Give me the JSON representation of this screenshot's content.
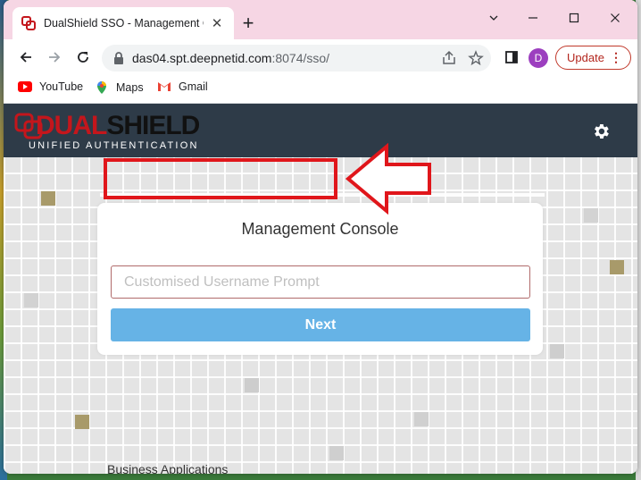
{
  "browser": {
    "tab_title": "DualShield SSO - Management C",
    "new_tab_symbol": "+",
    "url_host": "das04.spt.deepnetid.com",
    "url_rest": ":8074/sso/",
    "profile_initial": "D",
    "update_label": "Update",
    "window_controls": {
      "minimize": "—",
      "maximize": "☐",
      "close": "✕"
    }
  },
  "bookmarks": [
    {
      "label": "YouTube",
      "icon": "youtube-icon"
    },
    {
      "label": "Maps",
      "icon": "maps-icon"
    },
    {
      "label": "Gmail",
      "icon": "gmail-icon"
    }
  ],
  "app": {
    "logo_primary": "DUAL",
    "logo_secondary": "SHIELD",
    "logo_tagline": "UNIFIED AUTHENTICATION",
    "settings_icon": "gear-icon",
    "header_color": "#2e3b48",
    "brand_red": "#c4161c"
  },
  "login": {
    "title": "Management Console",
    "username_placeholder": "Customised Username Prompt",
    "username_value": "",
    "next_label": "Next",
    "next_color": "#66b3e6"
  },
  "annotation": {
    "color": "#e0161b"
  },
  "background_partial_text": "Business Applications"
}
